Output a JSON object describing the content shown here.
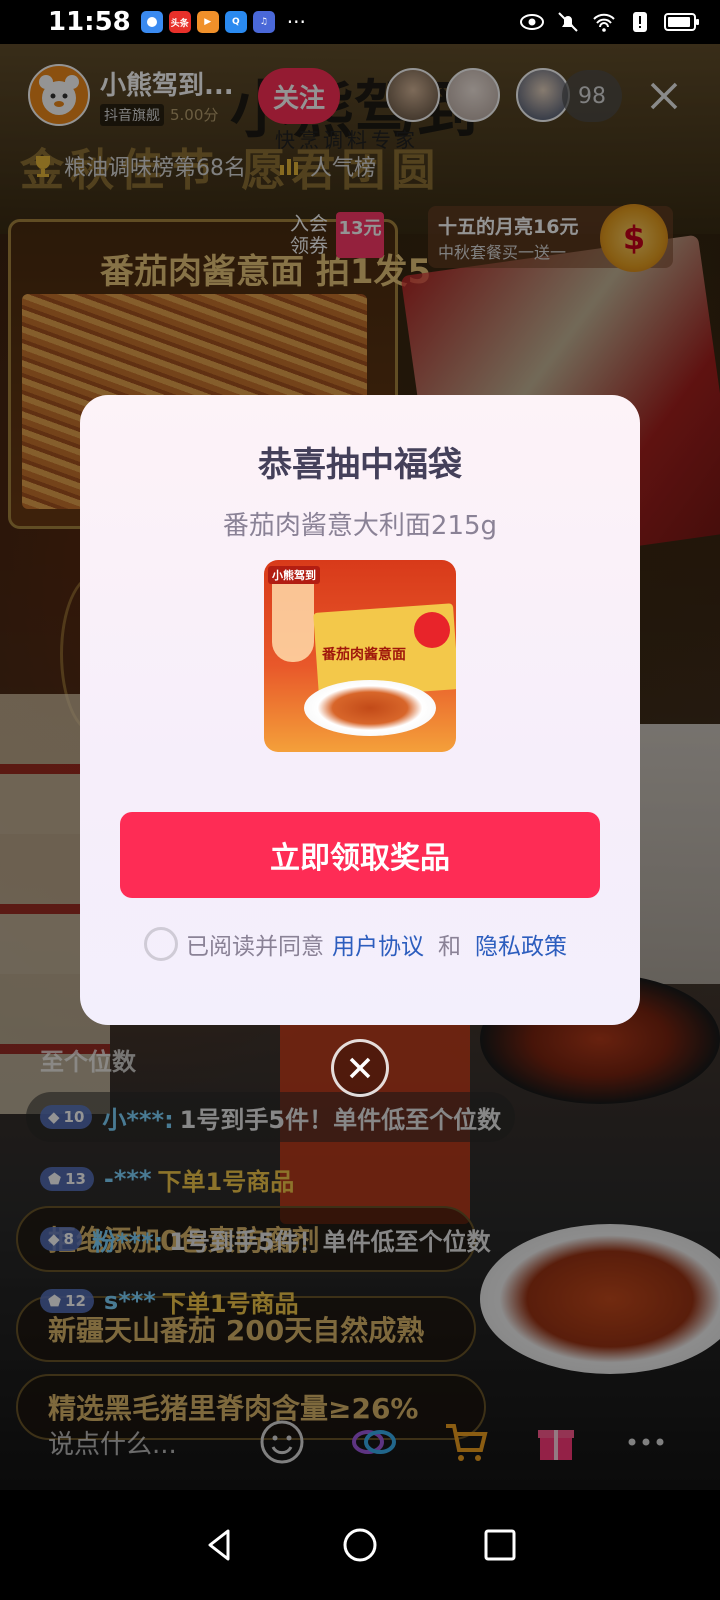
{
  "status_bar": {
    "time": "11:58",
    "app_icons": [
      {
        "name": "browser-app-icon",
        "label": "",
        "color": "#3a8af0"
      },
      {
        "name": "toutiao-app-icon",
        "label": "头条",
        "color": "#e8302a"
      },
      {
        "name": "video-app-icon",
        "label": "▶",
        "color": "#f0902a"
      },
      {
        "name": "search-app-icon",
        "label": "Q",
        "color": "#2a8af0"
      },
      {
        "name": "music-app-icon",
        "label": "♫",
        "color": "#4a68d8"
      }
    ],
    "more": "···"
  },
  "header": {
    "anchor_name": "小熊驾到...",
    "flagship_tag": "抖音旗舰",
    "score": "5.00分",
    "follow_label": "关注",
    "viewer_count": "98"
  },
  "background": {
    "brand": "小熊驾到",
    "brand_sub": "快烹调料专家",
    "festival_banner": "金秋佳节 愿君团圆",
    "promo_title": "番茄肉酱意面 拍1发5"
  },
  "rank": {
    "category_rank": "粮油调味榜第68名",
    "popularity": "人气榜"
  },
  "member_coupon": {
    "label_line1": "入会",
    "label_line2": "领券",
    "amount": "13元"
  },
  "moon_promo": {
    "title": "十五的月亮16元",
    "subtitle": "中秋套餐买一送一"
  },
  "modal": {
    "title": "恭喜抽中福袋",
    "product_name": "番茄肉酱意大利面215g",
    "image_logo": "小熊驾到",
    "image_box_text": "番茄肉酱意面",
    "claim_label": "立即领取奖品",
    "agree_prefix": "已阅读并同意",
    "agreement_link": "用户协议",
    "and_text": "和",
    "privacy_link": "隐私政策"
  },
  "chat": {
    "ghost_text": "至个位数",
    "messages": [
      {
        "level": "10",
        "user": "小***:",
        "text": "1号到手5件！单件低至个位数",
        "user_color": "#7fd4ff",
        "text_color": "#e8e8e8"
      },
      {
        "level": "13",
        "user": "-***",
        "text": "下单1号商品",
        "user_color": "#7fd4ff",
        "text_color": "#f3c84a"
      },
      {
        "level": "8",
        "user": "粉***:",
        "text": "1号到手5件！单件低至个位数",
        "user_color": "#7fd4ff",
        "text_color": "#e8e8e8"
      },
      {
        "level": "12",
        "user": "s***",
        "text": "下单1号商品",
        "user_color": "#7fd4ff",
        "text_color": "#f3c84a"
      }
    ],
    "bands": [
      "拒绝添加0色素防腐剂",
      "新疆天山番茄 200天自然成熟",
      "精选黑毛猪里脊肉含量≥26%"
    ]
  },
  "bottom_bar": {
    "input_placeholder": "说点什么..."
  }
}
